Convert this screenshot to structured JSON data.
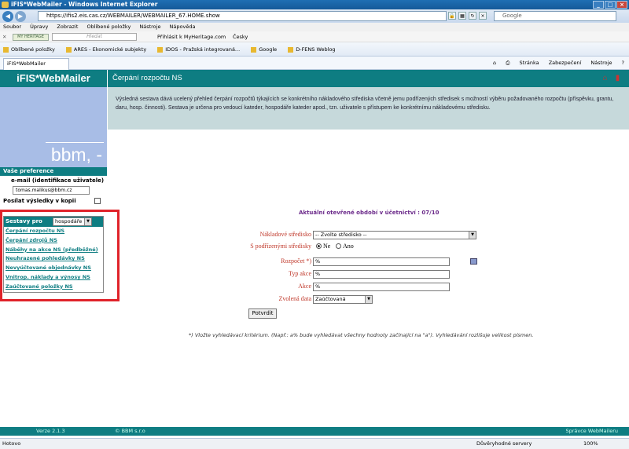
{
  "window": {
    "title": "iFIS*WebMailer - Windows Internet Explorer"
  },
  "address": {
    "url": "https://ifis2.eis.cas.cz/WEBMAILER/WEBMAILER_67.HOME.show",
    "search_placeholder": "Google"
  },
  "menu": [
    "Soubor",
    "Úpravy",
    "Zobrazit",
    "Oblíbené položky",
    "Nástroje",
    "Nápověda"
  ],
  "toolbar2": {
    "search_placeholder": "Hledat",
    "heritage": "Přihlásit k MyHeritage.com",
    "lang": "Česky"
  },
  "favorites": [
    "Oblíbené položky",
    "ARES - Ekonomické subjekty",
    "IDOS - Pražská integrovaná...",
    "Google",
    "D-FENS Weblog"
  ],
  "tab": {
    "label": "iFIS*WebMailer"
  },
  "tabtools": [
    "Stránka",
    "Zabezpečení",
    "Nástroje"
  ],
  "app": {
    "brand": "iFIS*WebMailer",
    "page_title": "Čerpání rozpočtu NS",
    "logo_text": "bbm, -",
    "description": "Výsledná sestava dává ucelený přehled čerpání rozpočtů týkajících se konkrétního nákladového střediska včetně jemu podřízených středisek s možností výběru požadovaného rozpočtu (příspěvku, grantu, daru, hosp. činnosti). Sestava je určena pro vedoucí kateder, hospodáře kateder apod., tzn. uživatele s přístupem ke konkrétnímu nákladovému středisku.",
    "prefs": {
      "header": "Vaše preference",
      "email_label": "e-mail (identifikace uživatele)",
      "email_value": "tomas.malikus@bbm.cz",
      "copy_label": "Posílat výsledky v kopii"
    },
    "reports": {
      "header": "Sestavy pro",
      "role": "hospodáře",
      "items": [
        "Čerpání rozpočtu NS",
        "Čerpání zdrojů NS",
        "Náběhy na akce NS (předběžné)",
        "Neuhrazené pohledávky NS",
        "Nevyúčtované objednávky NS",
        "Vnitrop. náklady a výnosy NS",
        "Zaúčtované položky NS"
      ]
    },
    "period": "Aktuální otevřené období v účetnictví : 07/10",
    "form": {
      "cost_center_label": "Nákladové středisko",
      "cost_center_value": "-- Zvolte středisko --",
      "sub_label": "S podřízenými středisky",
      "radio_no": "Ne",
      "radio_yes": "Ano",
      "budget_label": "Rozpočet *)",
      "budget_value": "%",
      "type_label": "Typ akce",
      "type_value": "%",
      "action_label": "Akce",
      "action_value": "%",
      "data_label": "Zvolená data",
      "data_value": "Zaúčtovaná",
      "submit": "Potvrdit"
    },
    "note": "*) Vložte vyhledávací kritérium. (Např.: a% bude vyhledávat všechny hodnoty začínající na \"a\"). Vyhledávání rozlišuje velikost písmen.",
    "footer": {
      "version": "Verze 2.1.3",
      "copyright": "© BBM s.r.o",
      "admin": "Správce WebMaileru"
    }
  },
  "status": {
    "left": "Hotovo",
    "zone": "Důvěryhodné servery",
    "zoom": "100%"
  }
}
